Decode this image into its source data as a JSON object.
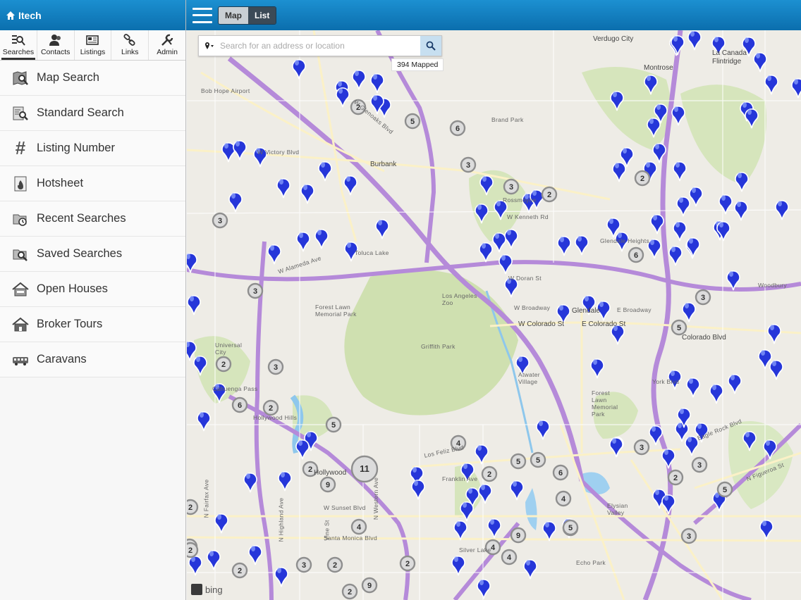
{
  "app": {
    "title": "Itech"
  },
  "tabs": [
    {
      "label": "Searches",
      "icon": "search-list-icon",
      "active": true
    },
    {
      "label": "Contacts",
      "icon": "contacts-icon"
    },
    {
      "label": "Listings",
      "icon": "listings-icon"
    },
    {
      "label": "Links",
      "icon": "link-icon"
    },
    {
      "label": "Admin",
      "icon": "wrench-icon"
    }
  ],
  "menu": [
    {
      "label": "Map Search",
      "icon": "map-search-icon"
    },
    {
      "label": "Standard Search",
      "icon": "standard-search-icon"
    },
    {
      "label": "Listing Number",
      "icon": "hash-icon"
    },
    {
      "label": "Hotsheet",
      "icon": "hotsheet-icon"
    },
    {
      "label": "Recent Searches",
      "icon": "recent-searches-icon"
    },
    {
      "label": "Saved Searches",
      "icon": "saved-searches-icon"
    },
    {
      "label": "Open Houses",
      "icon": "open-house-icon"
    },
    {
      "label": "Broker Tours",
      "icon": "broker-tour-icon"
    },
    {
      "label": "Caravans",
      "icon": "caravan-icon"
    }
  ],
  "topbar": {
    "view_map": "Map",
    "view_list": "List"
  },
  "search": {
    "placeholder": "Search for an address or location",
    "mapped": "394 Mapped"
  },
  "map": {
    "provider": "bing",
    "labels": [
      "Verdugo City",
      "La Canada Flintridge",
      "Montrose",
      "Bob Hope Airport",
      "Burbank",
      "Brand Park",
      "Glendale",
      "Griffith Park",
      "Forest Lawn Memorial Park",
      "Los Angeles Zoo",
      "Universal City",
      "Hollywood",
      "Los Feliz Blvd",
      "Franklin Ave",
      "W Sunset Blvd",
      "Santa Monica Blvd",
      "W Alameda Ave",
      "W Victory Blvd",
      "W Glenoaks Blvd",
      "E Colorado St",
      "Colorado Blvd",
      "W Colorado St",
      "Eagle Rock Blvd",
      "N Figueroa St",
      "Silver Lake",
      "Elysian Valley",
      "Echo Park",
      "N Western Ave",
      "N Highland Ave",
      "Vine St",
      "N Fairfax Ave",
      "W Broadway",
      "E Broadway",
      "York Blvd",
      "Atwater Village",
      "Forest Lawn Memorial Park",
      "Rossmoyne",
      "Glendale Heights",
      "W Doran St",
      "W Kenneth Rd",
      "Toluca Lake",
      "Cahuenga Pass",
      "Hollywood Hills",
      "Woodbury"
    ],
    "clusters": [
      "2",
      "5",
      "6",
      "3",
      "3",
      "2",
      "2",
      "3",
      "6",
      "3",
      "5",
      "2",
      "3",
      "6",
      "2",
      "5",
      "4",
      "2",
      "11",
      "9",
      "3",
      "5",
      "5",
      "2",
      "6",
      "3",
      "2",
      "5",
      "4",
      "4",
      "9",
      "2",
      "4",
      "2",
      "2",
      "2",
      "3",
      "2",
      "2",
      "4",
      "2",
      "9",
      "3",
      "2",
      "5",
      "3"
    ],
    "pin_color": "#2636d9"
  }
}
